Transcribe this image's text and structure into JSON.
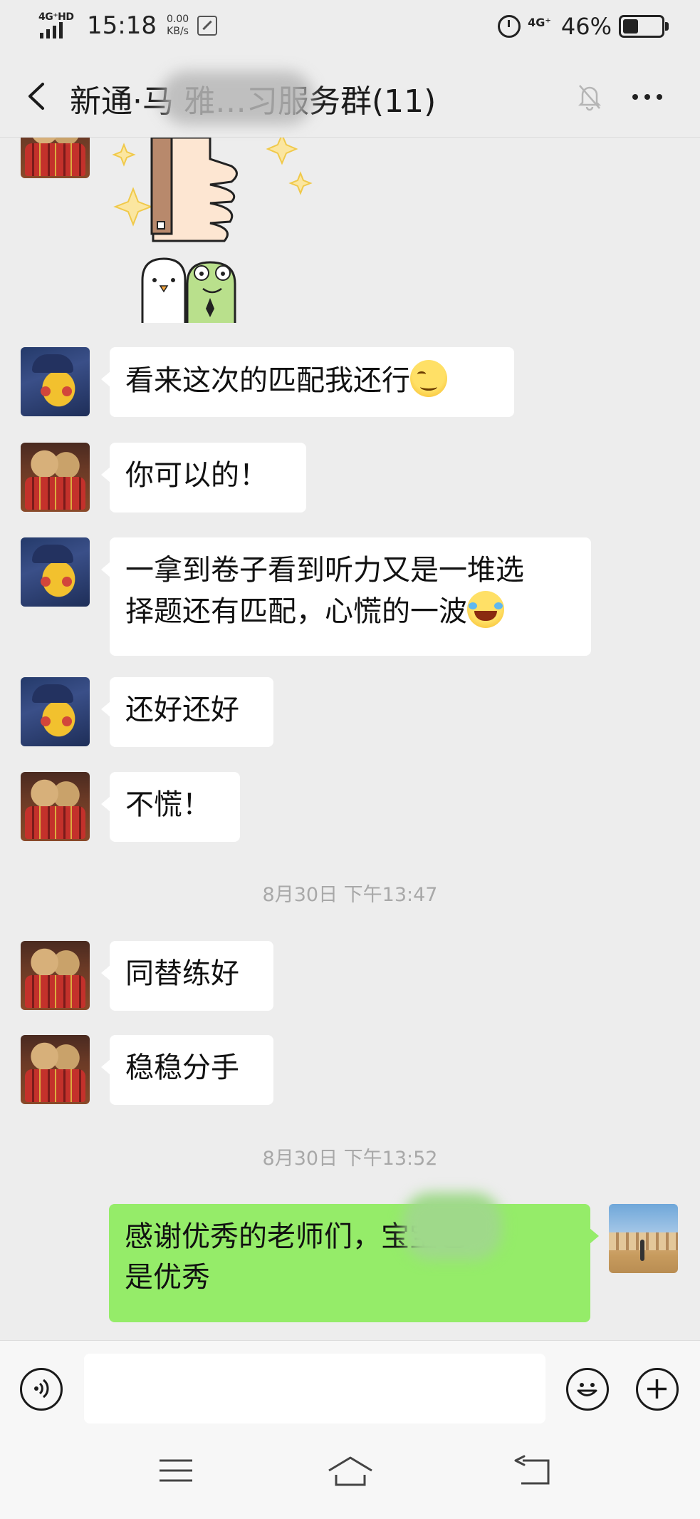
{
  "status_bar": {
    "network": "4G⁺HD",
    "time": "15:18",
    "speed_value": "0.00",
    "speed_unit": "KB/s",
    "network2": "4G⁺",
    "battery_percent": "46%",
    "battery_level": 0.46
  },
  "header": {
    "title": "新通·马 雅…习服务群(11)"
  },
  "messages": [
    {
      "type": "sticker",
      "sender": "dog"
    },
    {
      "type": "text",
      "sender": "pikachu",
      "text": "看来这次的匹配我还行",
      "emoji": "smirk-emoji"
    },
    {
      "type": "text",
      "sender": "dog",
      "text": "你可以的！"
    },
    {
      "type": "text",
      "sender": "pikachu",
      "lines": [
        "一拿到卷子看到听力又是一堆选",
        "择题还有匹配，心慌的一波"
      ],
      "emoji": "laugh-cry-emoji"
    },
    {
      "type": "text",
      "sender": "pikachu",
      "text": "还好还好"
    },
    {
      "type": "text",
      "sender": "dog",
      "text": "不慌！"
    },
    {
      "type": "time",
      "text": "8月30日 下午13:47"
    },
    {
      "type": "text",
      "sender": "dog",
      "text": "同替练好"
    },
    {
      "type": "text",
      "sender": "dog",
      "text": "稳稳分手"
    },
    {
      "type": "time",
      "text": "8月30日 下午13:52"
    },
    {
      "type": "text",
      "sender": "me",
      "lines": [
        "感谢优秀的老师们，宝宝也",
        "是优秀"
      ]
    }
  ],
  "input_bar": {
    "voice_icon": "voice-icon",
    "emoji_icon": "emoji-icon",
    "plus_icon": "plus-icon"
  },
  "system_nav": {
    "menu_icon": "menu-icon",
    "home_icon": "home-icon",
    "back_icon": "back-icon"
  }
}
